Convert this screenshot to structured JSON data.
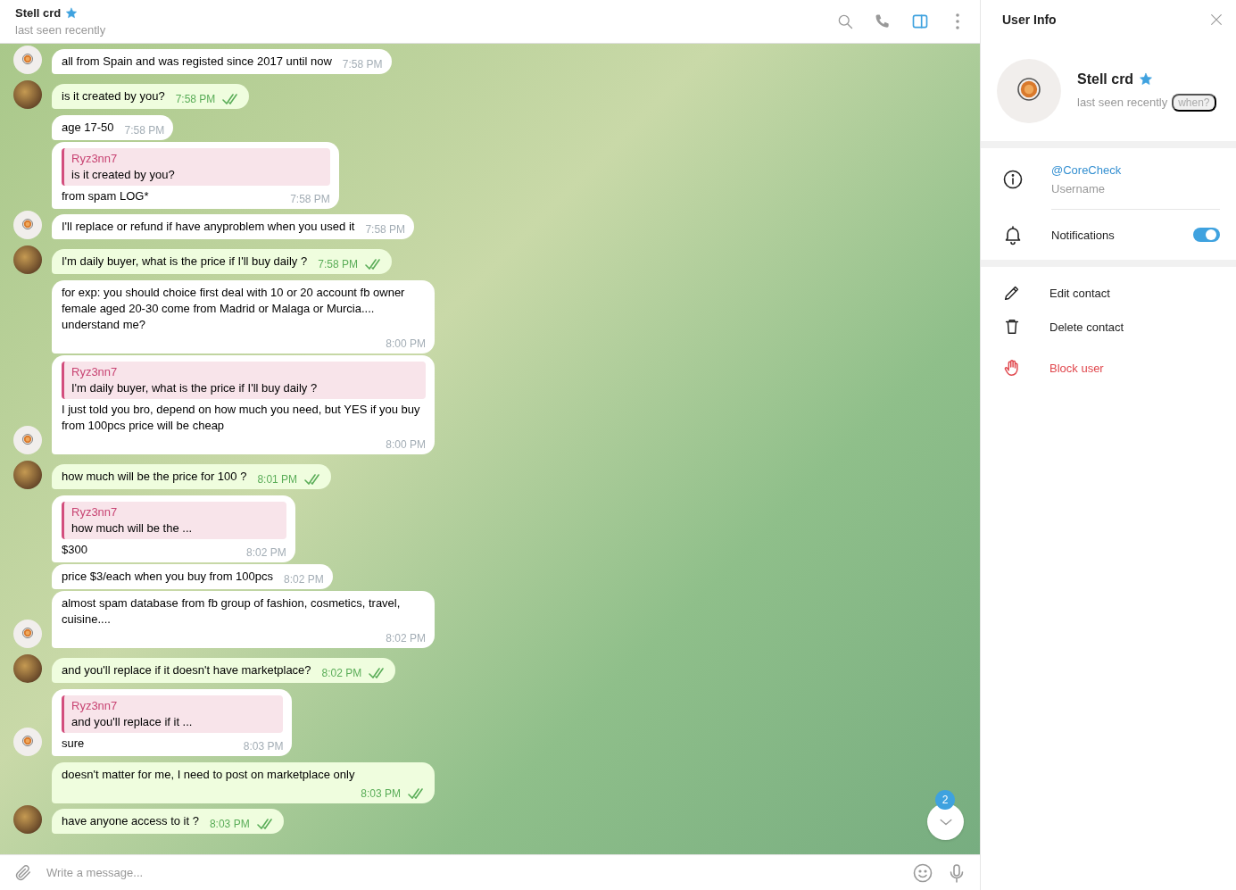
{
  "chat_header": {
    "name": "Stell crd",
    "starred": true,
    "status": "last seen recently",
    "tools": [
      {
        "kind": "search",
        "selected": false
      },
      {
        "kind": "phone",
        "selected": false
      },
      {
        "kind": "sidebar",
        "selected": true
      },
      {
        "kind": "more",
        "selected": false
      }
    ]
  },
  "messages": [
    {
      "kind": "incoming",
      "text": "all from Spain and was registed since 2017 until now",
      "time": "7:58 PM",
      "avatar": true
    },
    {
      "kind": "outgoing",
      "text": "is it created by you?",
      "time": "7:58 PM",
      "read": true,
      "avatar": true
    },
    {
      "kind": "incoming",
      "text": "age 17-50",
      "time": "7:58 PM",
      "avatar": false
    },
    {
      "kind": "incoming",
      "reply": {
        "author": "Ryz3nn7",
        "text": "is it created by you?"
      },
      "text": "from spam LOG*",
      "time": "7:58 PM",
      "avatar": false
    },
    {
      "kind": "incoming",
      "text": "I'll replace or refund if have anyproblem when you used it",
      "time": "7:58 PM",
      "avatar": true
    },
    {
      "kind": "outgoing",
      "text": "I'm daily buyer, what is the price if I'll buy daily ?",
      "time": "7:58 PM",
      "read": true,
      "avatar": true
    },
    {
      "kind": "incoming",
      "text": "for exp: you should choice first deal with 10 or 20 account fb owner female aged 20-30 come from Madrid or Malaga or Murcia.... understand me?",
      "time": "8:00 PM",
      "avatar": false
    },
    {
      "kind": "incoming",
      "reply": {
        "author": "Ryz3nn7",
        "text": "I'm daily buyer, what is the price if I'll buy daily ?"
      },
      "text": "I just told you bro, depend on how much you need, but YES if you buy from 100pcs price will be cheap",
      "time": "8:00 PM",
      "avatar": true
    },
    {
      "kind": "outgoing",
      "text": "how much will be the price for 100 ?",
      "time": "8:01 PM",
      "read": true,
      "avatar": true
    },
    {
      "kind": "incoming",
      "reply": {
        "author": "Ryz3nn7",
        "text": "how much will be the ..."
      },
      "text": "$300",
      "time": "8:02 PM",
      "avatar": false
    },
    {
      "kind": "incoming",
      "text": "price $3/each when you buy from 100pcs",
      "time": "8:02 PM",
      "avatar": false
    },
    {
      "kind": "incoming",
      "text": "almost spam database from fb group of fashion, cosmetics, travel, cuisine....",
      "time": "8:02 PM",
      "avatar": true
    },
    {
      "kind": "outgoing",
      "text": "and you'll replace if it doesn't have marketplace?",
      "time": "8:02 PM",
      "read": true,
      "avatar": true
    },
    {
      "kind": "incoming",
      "reply": {
        "author": "Ryz3nn7",
        "text": "and you'll replace if it ..."
      },
      "text": "sure",
      "time": "8:03 PM",
      "avatar": true
    },
    {
      "kind": "outgoing",
      "text": "doesn't matter for me, I need to post on marketplace only",
      "time": "8:03 PM",
      "read": true,
      "avatar": false
    },
    {
      "kind": "outgoing",
      "text": "have anyone access to it ?",
      "time": "8:03 PM",
      "read": true,
      "avatar": true
    }
  ],
  "scroll_down": {
    "badge": "2"
  },
  "composer": {
    "placeholder": "Write a message..."
  },
  "panel": {
    "title": "User Info",
    "name": "Stell crd",
    "starred": true,
    "status": "last seen recently",
    "when": "when?",
    "username": {
      "value": "@CoreCheck",
      "label": "Username"
    },
    "notifications": {
      "label": "Notifications",
      "on": true
    },
    "actions": [
      {
        "kind": "edit",
        "label": "Edit contact"
      },
      {
        "kind": "delete",
        "label": "Delete contact"
      },
      {
        "kind": "block",
        "label": "Block user"
      }
    ]
  }
}
